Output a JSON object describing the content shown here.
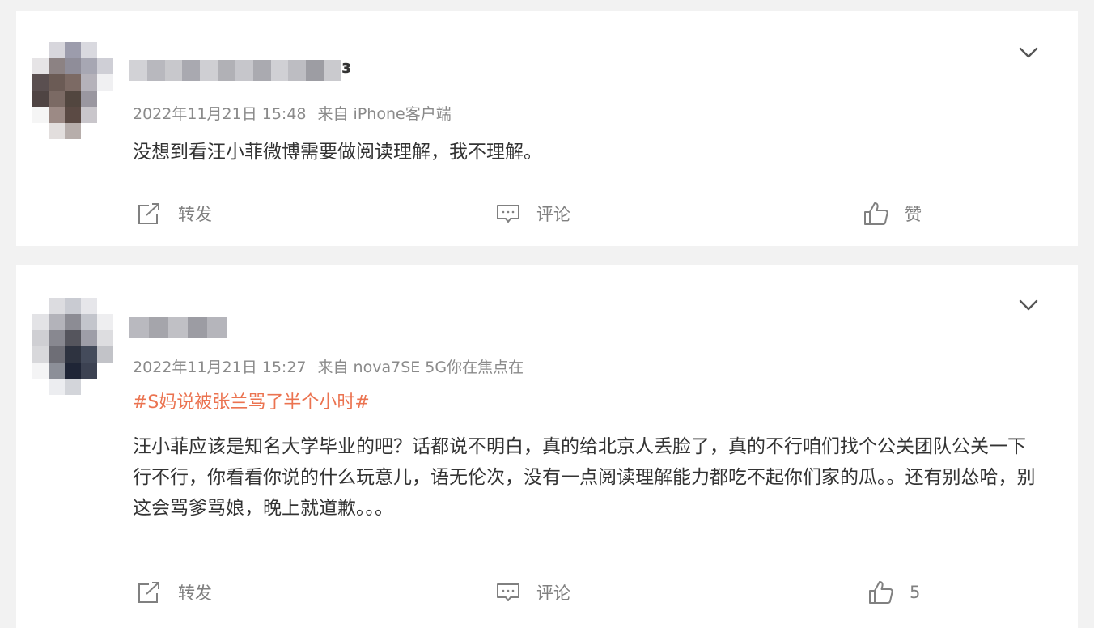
{
  "posts": [
    {
      "timestamp": "2022年11月21日 15:48",
      "source": "来自 iPhone客户端",
      "name_tail": "",
      "text": "没想到看汪小菲微博需要做阅读理解，我不理解。",
      "actions": {
        "repost": "转发",
        "comment": "评论",
        "like": "赞"
      }
    },
    {
      "timestamp": "2022年11月21日 15:27",
      "source": "来自 nova7SE 5G你在焦点在",
      "topic": "#S妈说被张兰骂了半个小时#",
      "text": "汪小菲应该是知名大学毕业的吧？话都说不明白，真的给北京人丢脸了，真的不行咱们找个公关团队公关一下行不行，你看看你说的什么玩意儿，语无伦次，没有一点阅读理解能力都吃不起你们家的瓜。。还有别怂哈，别这会骂爹骂娘，晚上就道歉。。。",
      "actions": {
        "repost": "转发",
        "comment": "评论",
        "like": "5"
      }
    }
  ],
  "icons": {
    "menu": "chevron-down-icon",
    "repost": "repost-icon",
    "comment": "comment-icon",
    "like": "thumbs-up-icon"
  },
  "colors": {
    "topic": "#eb7350",
    "meta": "#8a8a8a",
    "text": "#333333",
    "action": "#808080"
  }
}
